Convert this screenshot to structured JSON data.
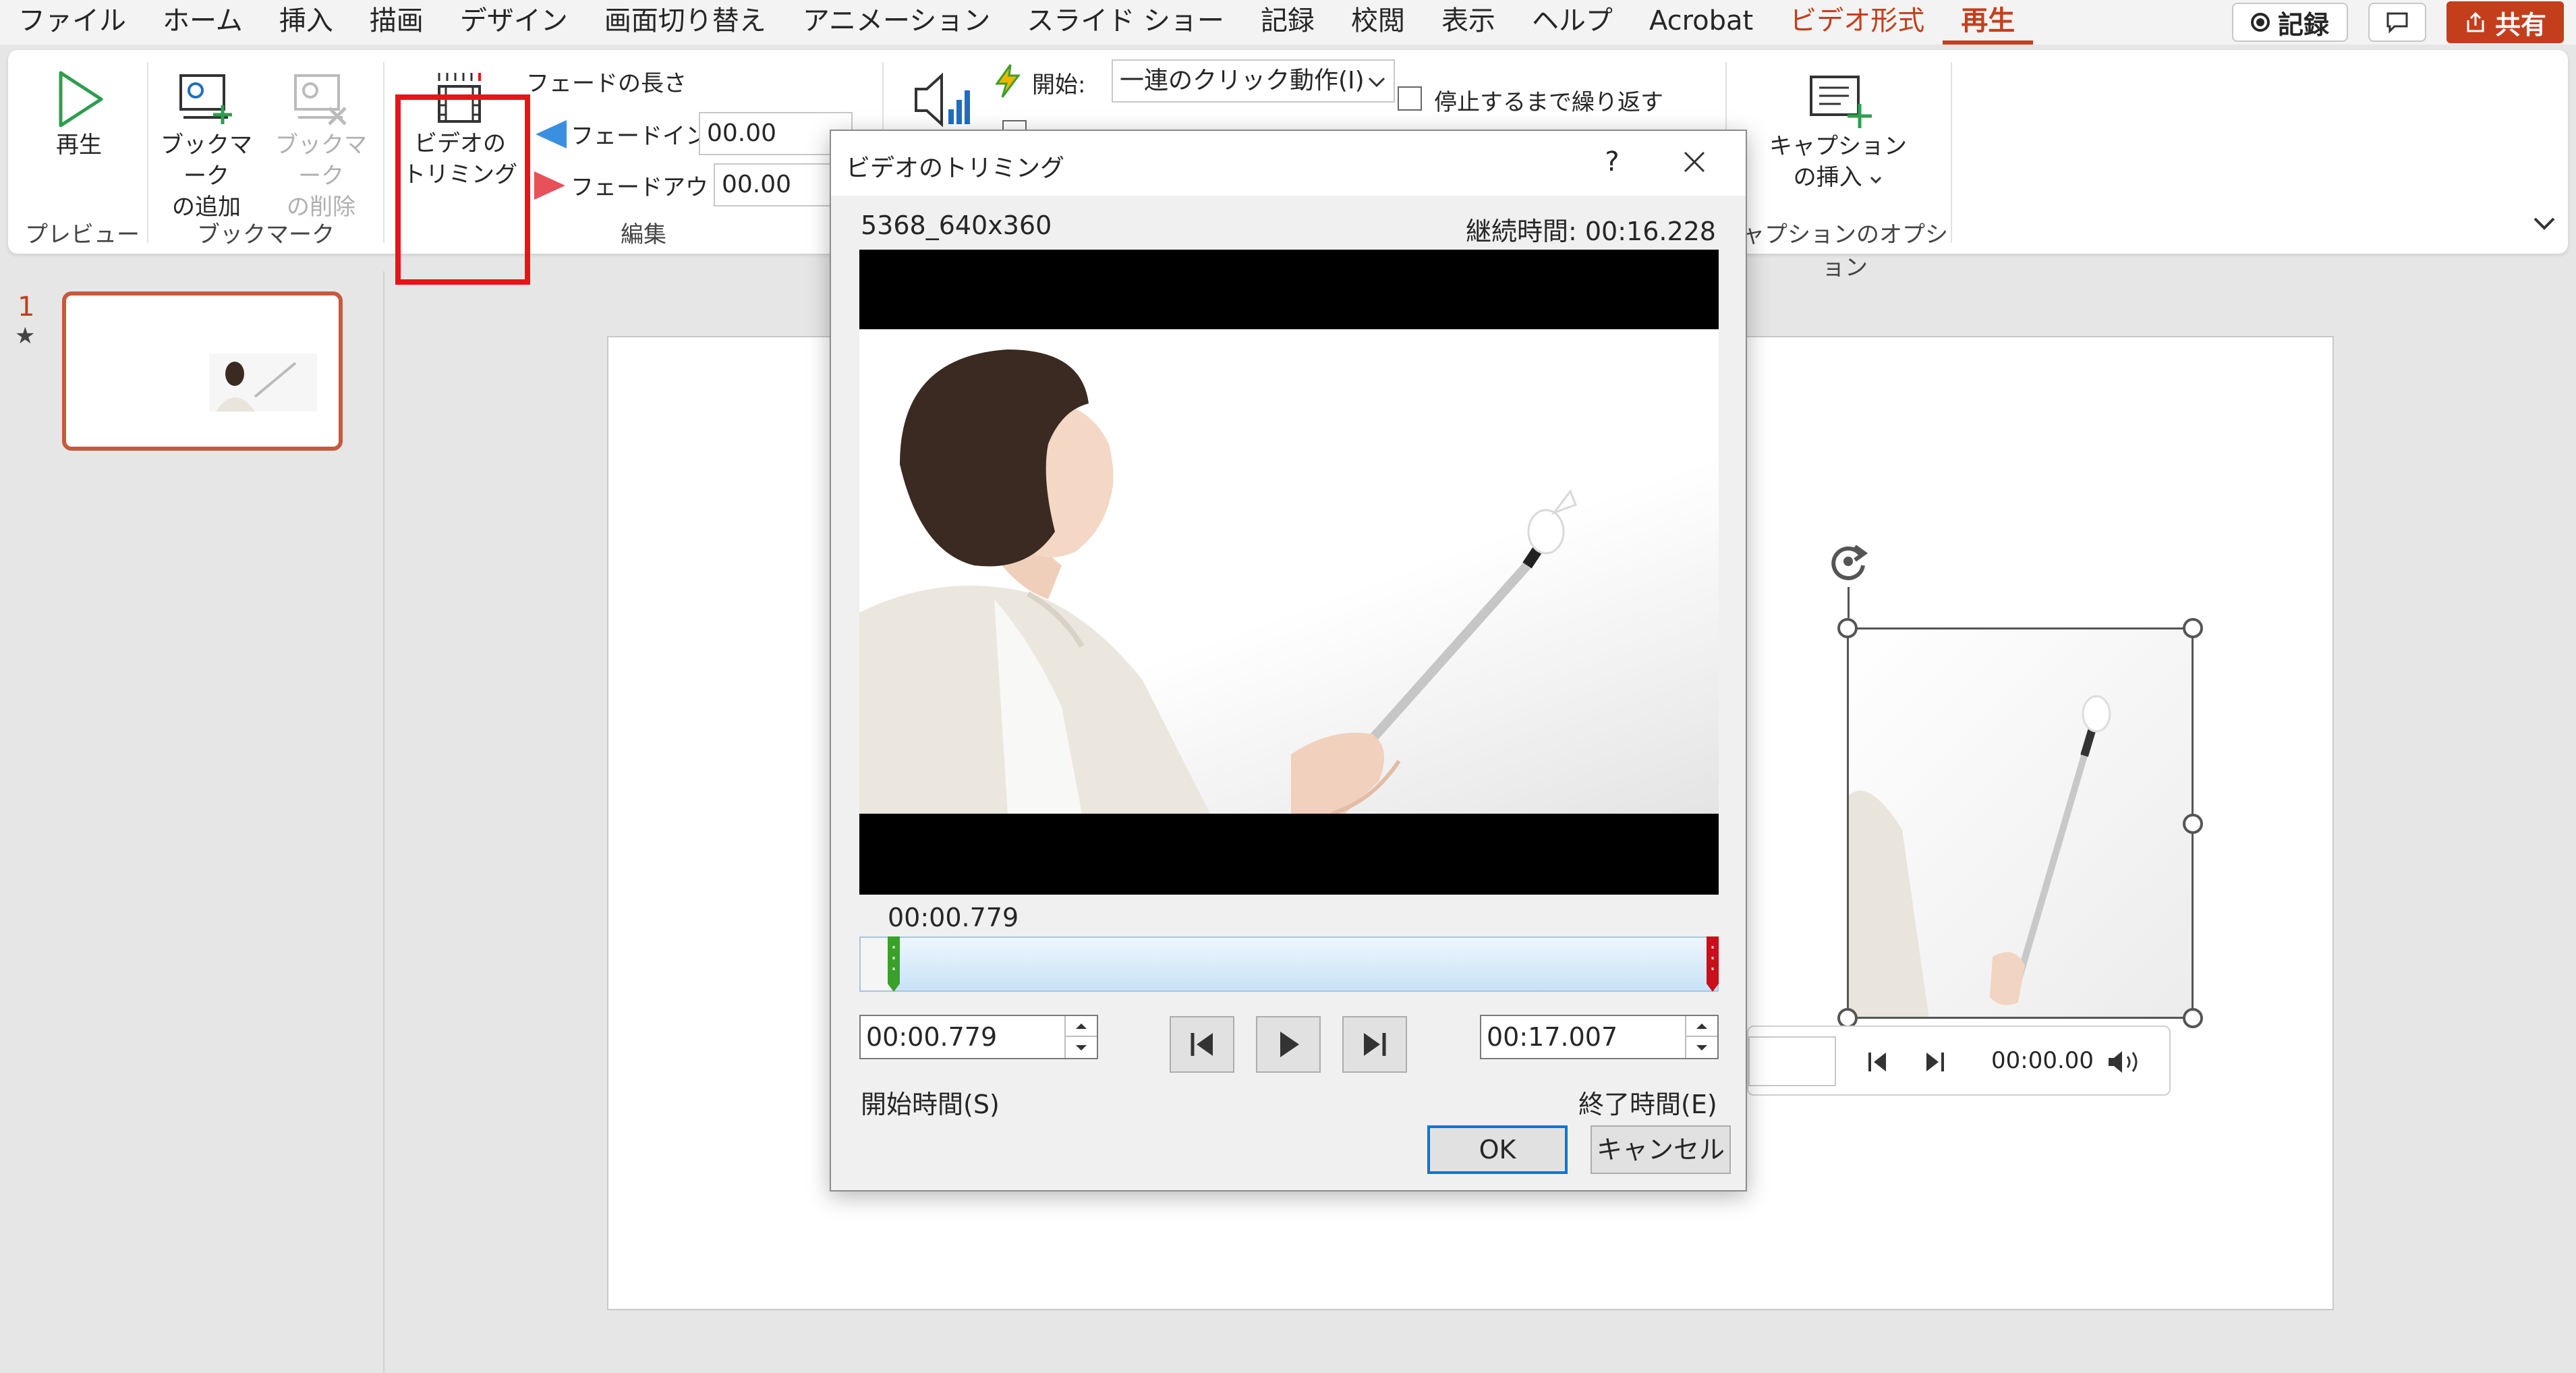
{
  "menubar": {
    "tabs": [
      "ファイル",
      "ホーム",
      "挿入",
      "描画",
      "デザイン",
      "画面切り替え",
      "アニメーション",
      "スライド ショー",
      "記録",
      "校閲",
      "表示",
      "ヘルプ",
      "Acrobat"
    ],
    "context_tab": "ビデオ形式",
    "active_tab": "再生",
    "record_label": "記録",
    "share_label": "共有"
  },
  "ribbon": {
    "play_label": "再生",
    "add_bookmark": [
      "ブックマーク",
      "の追加"
    ],
    "remove_bookmark": [
      "ブックマーク",
      "の削除"
    ],
    "trim_video": [
      "ビデオの",
      "トリミング"
    ],
    "fade_title": "フェードの長さ",
    "fade_in_label": "フェードイン:",
    "fade_in_value": "00.00",
    "fade_out_label": "フェードアウト:",
    "fade_out_value": "00.00",
    "start_label": "開始:",
    "start_value": "一連のクリック動作(I)",
    "loop_label": "停止するまで繰り返す",
    "insert_caption": [
      "キャプション",
      "の挿入"
    ],
    "groups": {
      "preview": "プレビュー",
      "bookmark": "ブックマーク",
      "edit": "編集",
      "caption_options": "ャプションのオプション"
    }
  },
  "slides": {
    "number": "1",
    "star": "★"
  },
  "player": {
    "time": "00:00.00"
  },
  "dialog": {
    "title": "ビデオのトリミング",
    "help": "?",
    "filename": "5368_640x360",
    "duration_label": "継続時間: 00:16.228",
    "current_time": "00:00.779",
    "start_time_value": "00:00.779",
    "end_time_value": "00:17.007",
    "start_time_label": "開始時間(S)",
    "end_time_label": "終了時間(E)",
    "ok_label": "OK",
    "cancel_label": "キャンセル"
  },
  "colors": {
    "accent": "#c43e1c",
    "highlight": "#e8141a",
    "start_marker": "#3aa02a",
    "end_marker": "#c8101a",
    "ok_border": "#0078d7"
  }
}
